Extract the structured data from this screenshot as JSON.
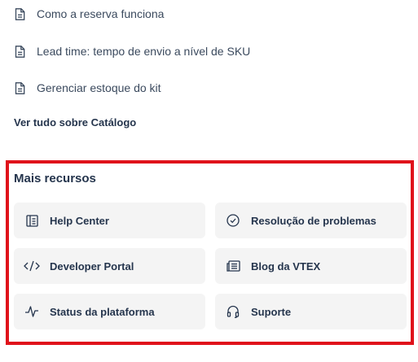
{
  "doc_links": [
    {
      "label": "Como a reserva funciona",
      "icon": "document-icon"
    },
    {
      "label": "Lead time: tempo de envio a nível de SKU",
      "icon": "document-icon"
    },
    {
      "label": "Gerenciar estoque do kit",
      "icon": "document-icon"
    }
  ],
  "see_all_label": "Ver tudo sobre Catálogo",
  "resources": {
    "title": "Mais recursos",
    "highlight_color": "#e0121b",
    "items": [
      {
        "label": "Help Center",
        "icon": "help-center-icon"
      },
      {
        "label": "Resolução de problemas",
        "icon": "check-circle-icon"
      },
      {
        "label": "Developer Portal",
        "icon": "code-icon"
      },
      {
        "label": "Blog da VTEX",
        "icon": "newspaper-icon"
      },
      {
        "label": "Status da plataforma",
        "icon": "pulse-icon"
      },
      {
        "label": "Suporte",
        "icon": "headset-icon"
      }
    ]
  }
}
